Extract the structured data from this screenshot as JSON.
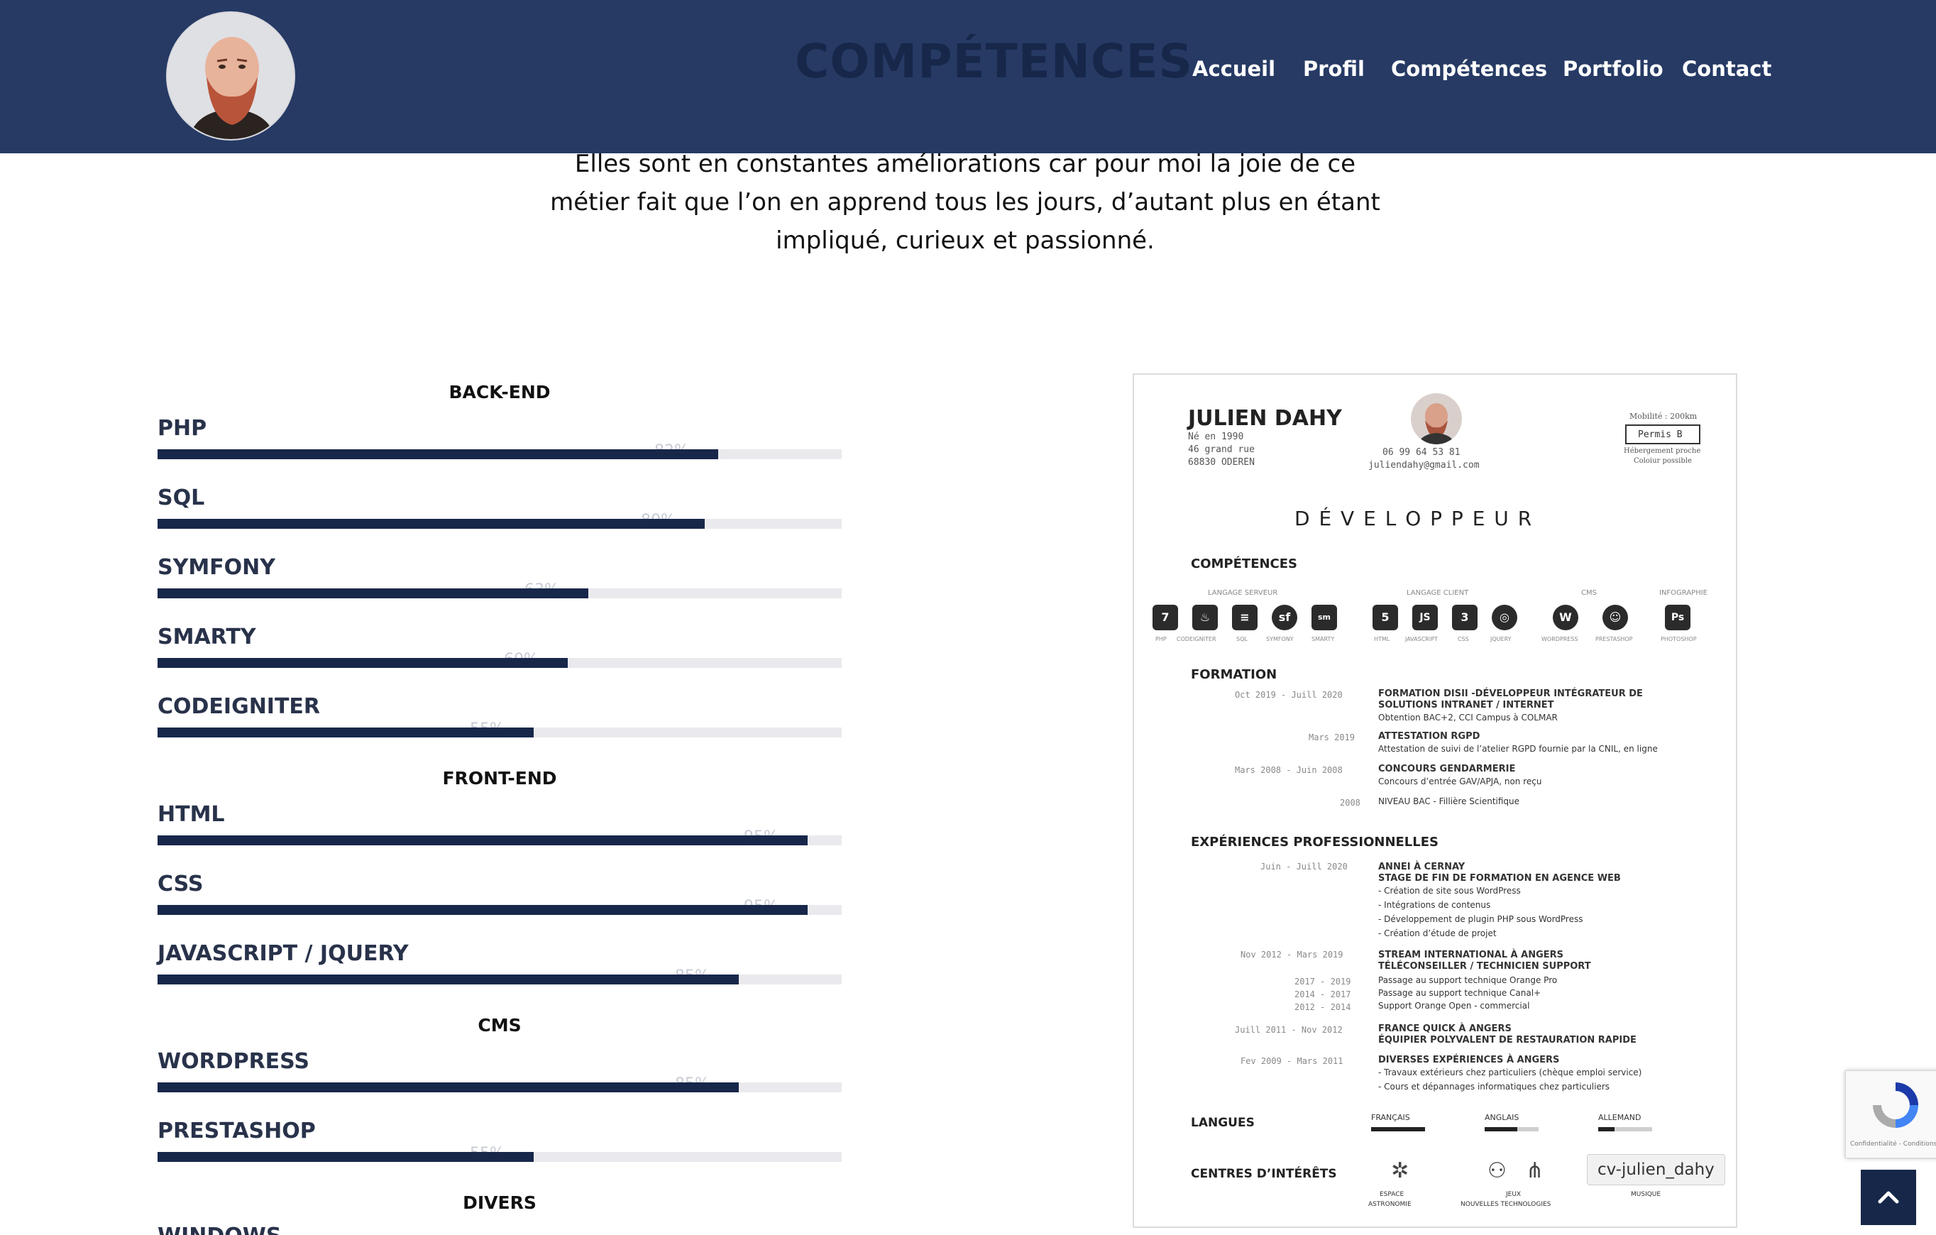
{
  "header": {
    "page_heading": "COMPÉTENCES",
    "nav": [
      "Accueil",
      "Profil",
      "Compétences",
      "Portfolio",
      "Contact"
    ],
    "avatar_icon": "avatar-icon"
  },
  "intro": {
    "lines": [
      "Elles sont en constantes améliorations car pour moi la joie de ce",
      "métier fait que l’on en apprend tous les jours, d’autant plus en étant",
      "impliqué, curieux et passionné."
    ]
  },
  "skills": {
    "sections": [
      {
        "title": "BACK-END",
        "items": [
          {
            "name": "PHP",
            "percent": 82,
            "label": "82%"
          },
          {
            "name": "SQL",
            "percent": 80,
            "label": "80%"
          },
          {
            "name": "SYMFONY",
            "percent": 63,
            "label": "63%"
          },
          {
            "name": "SMARTY",
            "percent": 60,
            "label": "60%"
          },
          {
            "name": "CODEIGNITER",
            "percent": 55,
            "label": "55%"
          }
        ]
      },
      {
        "title": "FRONT-END",
        "items": [
          {
            "name": "HTML",
            "percent": 95,
            "label": "95%"
          },
          {
            "name": "CSS",
            "percent": 95,
            "label": "95%"
          },
          {
            "name": "JAVASCRIPT / JQUERY",
            "percent": 85,
            "label": "85%"
          }
        ]
      },
      {
        "title": "CMS",
        "items": [
          {
            "name": "WORDPRESS",
            "percent": 85,
            "label": "85%"
          },
          {
            "name": "PRESTASHOP",
            "percent": 55,
            "label": "55%"
          }
        ]
      },
      {
        "title": "DIVERS",
        "items": [
          {
            "name": "WINDOWS"
          }
        ]
      }
    ]
  },
  "cv": {
    "name": "JULIEN DAHY",
    "born": "Né en 1990",
    "street": "46 grand rue",
    "city": "68830 ODEREN",
    "phone": "06 99 64 53 81",
    "email": "juliendahy@gmail.com",
    "mobility": "Mobilité : 200km",
    "permit": "Permis B",
    "housing": "Hébergement proche",
    "carpool": "Coloiur possible",
    "job": "D É V E L O P P E U R",
    "skills_title": "COMPÉTENCES",
    "cat_server": "LANGAGE SERVEUR",
    "cat_client": "LANGAGE CLIENT",
    "cat_cms": "CMS",
    "cat_infog": "INFOGRAPHIE",
    "icons": [
      {
        "glyph": "7",
        "label": "PHP"
      },
      {
        "glyph": "♨",
        "label": "CODEIGNITER"
      },
      {
        "glyph": "≡",
        "label": "SQL"
      },
      {
        "glyph": "sf",
        "label": "SYMFONY"
      },
      {
        "glyph": "sm",
        "label": "SMARTY"
      },
      {
        "glyph": "5",
        "label": "HTML"
      },
      {
        "glyph": "JS",
        "label": "JAVASCRIPT"
      },
      {
        "glyph": "3",
        "label": "CSS"
      },
      {
        "glyph": "◎",
        "label": "JQUERY"
      },
      {
        "glyph": "W",
        "label": "WORDPRESS"
      },
      {
        "glyph": "☺",
        "label": "PRESTASHOP"
      },
      {
        "glyph": "Ps",
        "label": "PHOTOSHOP"
      }
    ],
    "training_title": "FORMATION",
    "training": [
      {
        "date": "Oct 2019 - Juill 2020",
        "title": "FORMATION DISII -DÉVELOPPEUR INTÉGRATEUR DE",
        "title2": "SOLUTIONS INTRANET / INTERNET",
        "desc": "Obtention BAC+2, CCI Campus à COLMAR"
      },
      {
        "date": "Mars 2019",
        "title": "ATTESTATION RGPD",
        "title2": "",
        "desc": "Attestation de suivi de l’atelier RGPD fournie par la CNIL, en ligne"
      },
      {
        "date": "Mars 2008 - Juin 2008",
        "title": "CONCOURS GENDARMERIE",
        "title2": "",
        "desc": "Concours d’entrée GAV/APJA, non reçu"
      },
      {
        "date": "2008",
        "title": "NIVEAU BAC - Fillière Scientifique",
        "title2": "",
        "desc": ""
      }
    ],
    "exp_title": "EXPÉRIENCES PROFESSIONNELLES",
    "exp": [
      {
        "date": "Juin - Juill 2020",
        "lines": [
          "ANNEI À CERNAY",
          "STAGE DE FIN DE FORMATION EN AGENCE WEB",
          "- Création de site sous WordPress",
          "- Intégrations de contenus",
          "- Développement de plugin PHP sous WordPress",
          "- Création d’étude de projet"
        ]
      },
      {
        "date": "Nov 2012 - Mars 2019",
        "lines": [
          "STREAM INTERNATIONAL À ANGERS",
          "TÉLÉCONSEILLER / TECHNICIEN SUPPORT"
        ]
      },
      {
        "date": "2017 - 2019",
        "lines": [
          "Passage au support technique Orange Pro"
        ]
      },
      {
        "date": "2014 - 2017",
        "lines": [
          "Passage au support technique Canal+"
        ]
      },
      {
        "date": "2012 - 2014",
        "lines": [
          "Support Orange Open - commercial"
        ]
      },
      {
        "date": "Juill 2011 - Nov 2012",
        "lines": [
          "FRANCE QUICK À ANGERS",
          "ÉQUIPIER POLYVALENT DE RESTAURATION RAPIDE"
        ]
      },
      {
        "date": "Fev 2009 - Mars 2011",
        "lines": [
          "DIVERSES EXPÉRIENCES À ANGERS",
          "- Travaux extérieurs chez particuliers (chèque emploi service)",
          "- Cours et dépannages informatiques chez particuliers"
        ]
      }
    ],
    "lang_title": "LANGUES",
    "langs": [
      {
        "name": "FRANÇAIS",
        "level": 1.0
      },
      {
        "name": "ANGLAIS",
        "level": 0.6
      },
      {
        "name": "ALLEMAND",
        "level": 0.3
      }
    ],
    "interests_title": "CENTRES D’INTÉRÊTS",
    "interests": [
      "ESPACE",
      "ASTRONOMIE",
      "JEUX",
      "NOUVELLES TECHNOLOGIES",
      "MUSIQUE"
    ]
  },
  "widgets": {
    "tooltip": "cv-julien_dahy",
    "recaptcha_text": "Confidentialité - Conditions",
    "back_to_top_icon": "chevron-up-icon"
  }
}
